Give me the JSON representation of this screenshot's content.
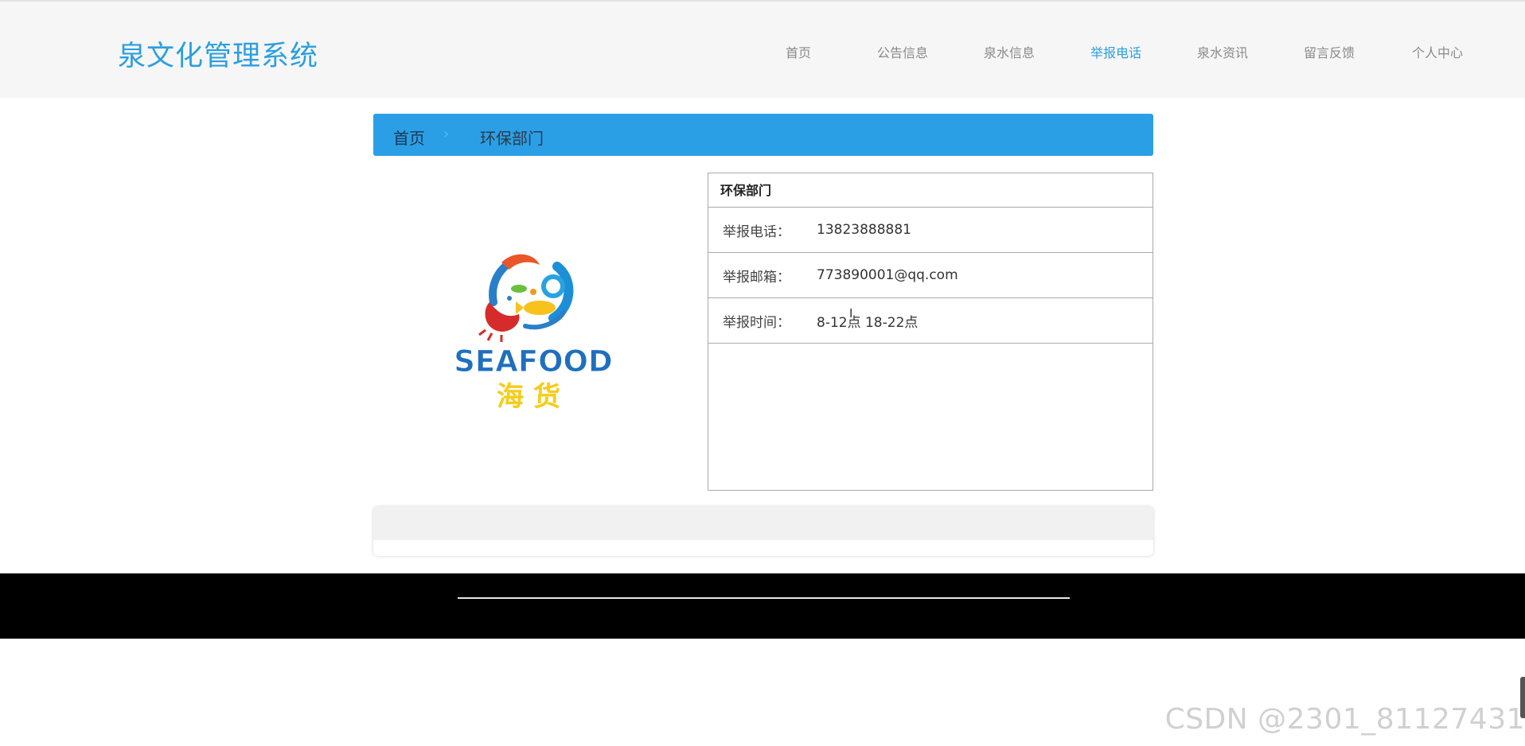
{
  "header": {
    "brand": "泉文化管理系统",
    "nav": [
      {
        "label": "首页",
        "active": false
      },
      {
        "label": "公告信息",
        "active": false
      },
      {
        "label": "泉水信息",
        "active": false
      },
      {
        "label": "举报电话",
        "active": true
      },
      {
        "label": "泉水资讯",
        "active": false
      },
      {
        "label": "留言反馈",
        "active": false
      },
      {
        "label": "个人中心",
        "active": false
      }
    ]
  },
  "breadcrumb": {
    "home": "首页",
    "separator": "›",
    "current": "环保部门"
  },
  "logo": {
    "text_en": "SEAFOOD",
    "text_cn": "海货"
  },
  "detail": {
    "title": "环保部门",
    "rows": [
      {
        "label": "举报电话：",
        "value": "13823888881"
      },
      {
        "label": "举报邮箱：",
        "value": "773890001@qq.com"
      },
      {
        "label": "举报时间：",
        "value": "8-12点 18-22点"
      }
    ]
  },
  "colors": {
    "brand": "#2b9fe0",
    "nav_active": "#2b9fe0",
    "nav_default": "#8a8a8a",
    "breadcrumb_bg": "#2a9fe6",
    "footer_bg": "#000000"
  },
  "watermark": "CSDN @2301_81127431"
}
